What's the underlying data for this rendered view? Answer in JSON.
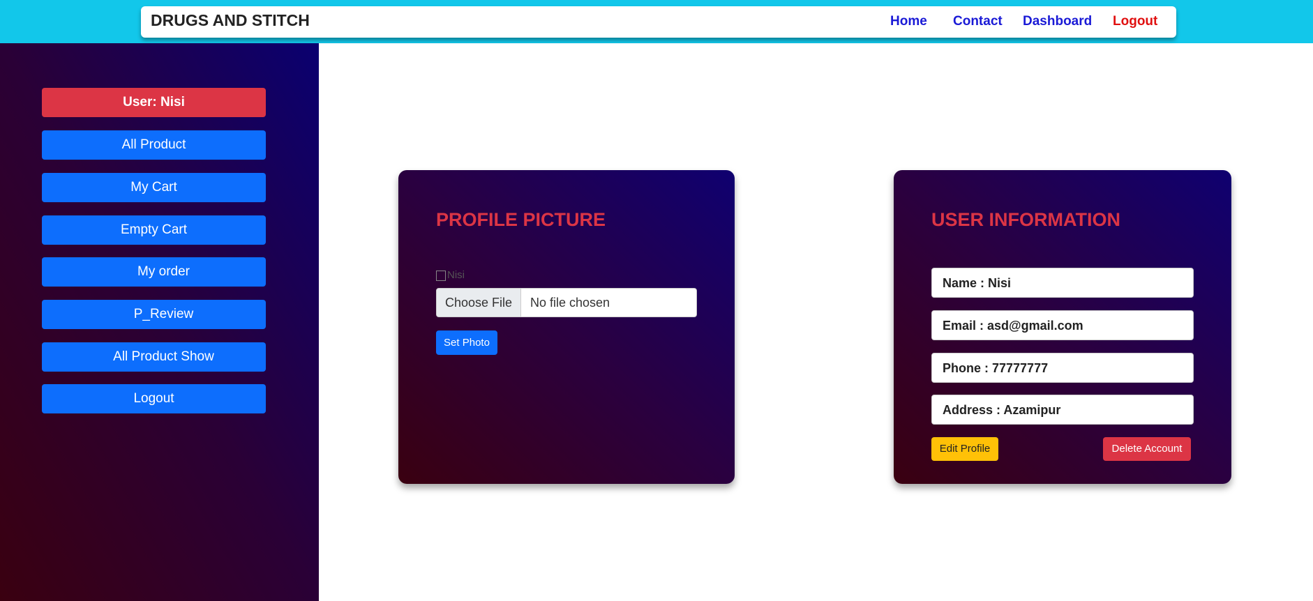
{
  "navbar": {
    "brand": "DRUGS AND STITCH",
    "links": [
      {
        "label": "Home",
        "color": "#1a1ad6"
      },
      {
        "label": "Contact",
        "color": "#1a1ad6"
      },
      {
        "label": "Dashboard",
        "color": "#1a1ad6"
      },
      {
        "label": "Logout",
        "color": "#e01010"
      }
    ]
  },
  "sidebar": {
    "user_label": "User: Nisi",
    "items": [
      {
        "label": "All Product"
      },
      {
        "label": "My Cart"
      },
      {
        "label": "Empty Cart"
      },
      {
        "label": "My order"
      },
      {
        "label": "P_Review"
      },
      {
        "label": "All Product Show"
      },
      {
        "label": "Logout"
      }
    ]
  },
  "profile_card": {
    "title": "PROFILE PICTURE",
    "image_alt": "Nisi",
    "file_button": "Choose File",
    "file_status": "No file chosen",
    "set_photo": "Set Photo"
  },
  "info_card": {
    "title": "USER INFORMATION",
    "fields": [
      {
        "label": "Name : Nisi"
      },
      {
        "label": "Email : asd@gmail.com"
      },
      {
        "label": "Phone : 77777777"
      },
      {
        "label": "Address : Azamipur"
      }
    ],
    "edit_button": "Edit Profile",
    "delete_button": "Delete Account"
  },
  "colors": {
    "topbar": "#12c7ea",
    "primary": "#0d6efd",
    "danger": "#dc3545",
    "warning": "#ffc107"
  }
}
